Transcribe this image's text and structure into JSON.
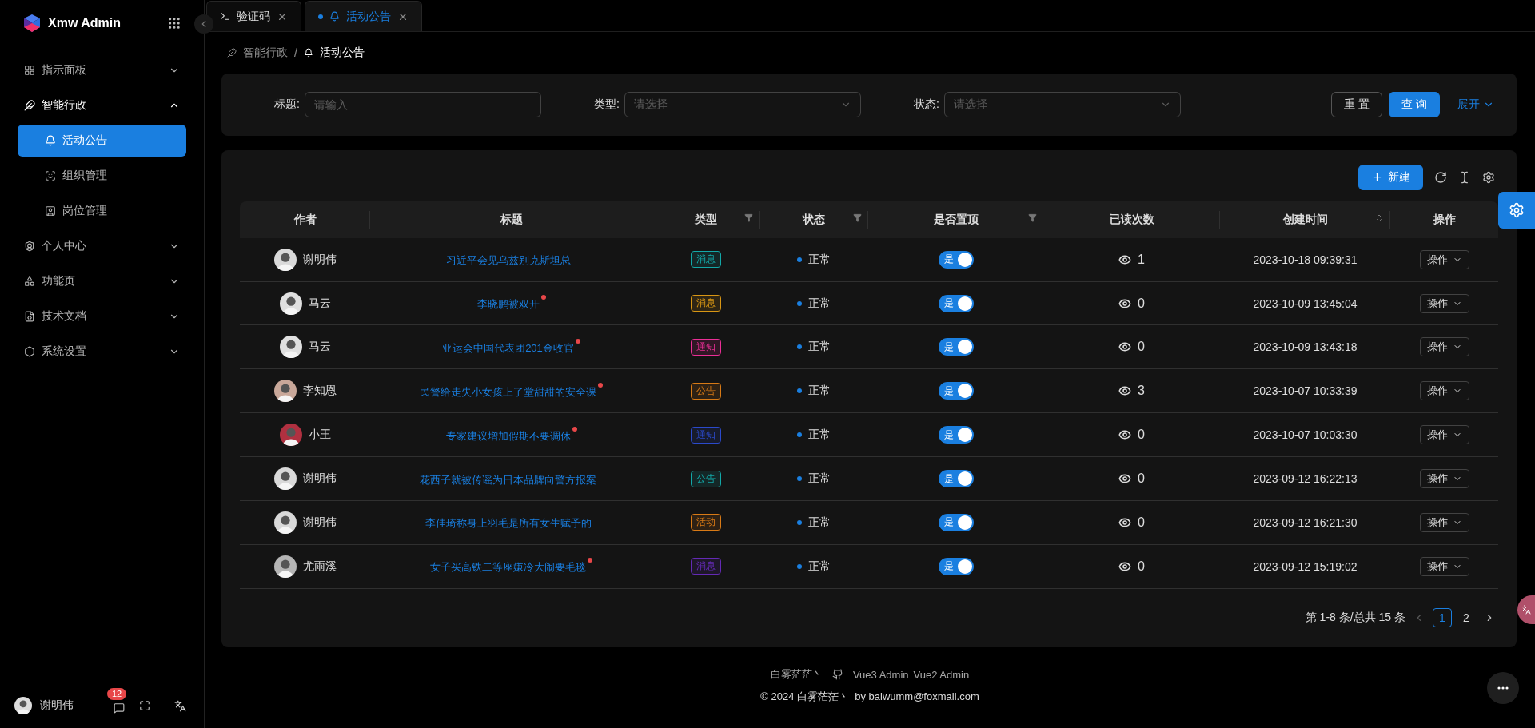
{
  "sidebar": {
    "brand": "Xmw Admin",
    "items": [
      {
        "label": "指示面板",
        "expanded": false
      },
      {
        "label": "智能行政",
        "expanded": true,
        "children": [
          {
            "label": "活动公告",
            "selected": true
          },
          {
            "label": "组织管理",
            "selected": false
          },
          {
            "label": "岗位管理",
            "selected": false
          }
        ]
      },
      {
        "label": "个人中心",
        "expanded": false
      },
      {
        "label": "功能页",
        "expanded": false
      },
      {
        "label": "技术文档",
        "expanded": false
      },
      {
        "label": "系统设置",
        "expanded": false
      }
    ],
    "user": {
      "name": "谢明伟",
      "badge": "12"
    }
  },
  "tabs": [
    {
      "label": "验证码",
      "selected": false
    },
    {
      "label": "活动公告",
      "selected": true
    }
  ],
  "breadcrumb": {
    "items": [
      "智能行政",
      "活动公告"
    ],
    "separator": "/"
  },
  "search": {
    "fields": [
      {
        "label": "标题:",
        "kind": "input",
        "placeholder": "请输入"
      },
      {
        "label": "类型:",
        "kind": "select",
        "placeholder": "请选择"
      },
      {
        "label": "状态:",
        "kind": "select",
        "placeholder": "请选择"
      }
    ],
    "reset": "重 置",
    "submit": "查 询",
    "expand": "展开"
  },
  "toolbar": {
    "create": "新建"
  },
  "table": {
    "columns": [
      {
        "label": "作者"
      },
      {
        "label": "标题"
      },
      {
        "label": "类型",
        "kind": "filter"
      },
      {
        "label": "状态",
        "kind": "filter"
      },
      {
        "label": "是否置顶",
        "kind": "filter"
      },
      {
        "label": "已读次数"
      },
      {
        "label": "创建时间",
        "kind": "sort"
      },
      {
        "label": "操作"
      }
    ],
    "rows": [
      {
        "author": "谢明伟",
        "title": "习近平会见乌兹别克斯坦总",
        "unread": false,
        "type": "消息",
        "color": "#13a8a8",
        "status": "正常",
        "pinned": true,
        "pin_label": "是",
        "reads": "1",
        "created": "2023-10-18 09:39:31",
        "action": "操作"
      },
      {
        "author": "马云",
        "title": "李晓鹏被双开",
        "unread": true,
        "type": "消息",
        "color": "#d89614",
        "status": "正常",
        "pinned": true,
        "pin_label": "是",
        "reads": "0",
        "created": "2023-10-09 13:45:04",
        "action": "操作"
      },
      {
        "author": "马云",
        "title": "亚运会中国代表团201金收官",
        "unread": true,
        "type": "通知",
        "color": "#eb2f96",
        "status": "正常",
        "pinned": true,
        "pin_label": "是",
        "reads": "0",
        "created": "2023-10-09 13:43:18",
        "action": "操作"
      },
      {
        "author": "李知恩",
        "title": "民警给走失小女孩上了堂甜甜的安全课",
        "unread": true,
        "type": "公告",
        "color": "#d87a16",
        "status": "正常",
        "pinned": true,
        "pin_label": "是",
        "reads": "3",
        "created": "2023-10-07 10:33:39",
        "action": "操作"
      },
      {
        "author": "小王",
        "title": "专家建议增加假期不要调休",
        "unread": true,
        "type": "通知",
        "color": "#2b4acb",
        "status": "正常",
        "pinned": true,
        "pin_label": "是",
        "reads": "0",
        "created": "2023-10-07 10:03:30",
        "action": "操作"
      },
      {
        "author": "谢明伟",
        "title": "花西子就被传谣为日本品牌向警方报案",
        "unread": false,
        "type": "公告",
        "color": "#13a8a8",
        "status": "正常",
        "pinned": true,
        "pin_label": "是",
        "reads": "0",
        "created": "2023-09-12 16:22:13",
        "action": "操作"
      },
      {
        "author": "谢明伟",
        "title": "李佳琦称身上羽毛是所有女生赋予的",
        "unread": false,
        "type": "活动",
        "color": "#d87a16",
        "status": "正常",
        "pinned": true,
        "pin_label": "是",
        "reads": "0",
        "created": "2023-09-12 16:21:30",
        "action": "操作"
      },
      {
        "author": "尤雨溪",
        "title": "女子买高铁二等座嫌冷大闹要毛毯",
        "unread": true,
        "type": "消息",
        "color": "#642ab5",
        "status": "正常",
        "pinned": true,
        "pin_label": "是",
        "reads": "0",
        "created": "2023-09-12 15:19:02",
        "action": "操作"
      }
    ]
  },
  "pagination": {
    "summary": "第 1-8 条/总共 15 条",
    "pages": [
      {
        "label": "1",
        "selected": true
      },
      {
        "label": "2",
        "selected": false
      }
    ]
  },
  "footer": {
    "links": [
      "白雾茫茫丶",
      "Vue3 Admin",
      "Vue2 Admin"
    ],
    "copyright": "© 2024 白雾茫茫丶  by baiwumm@foxmail.com"
  }
}
